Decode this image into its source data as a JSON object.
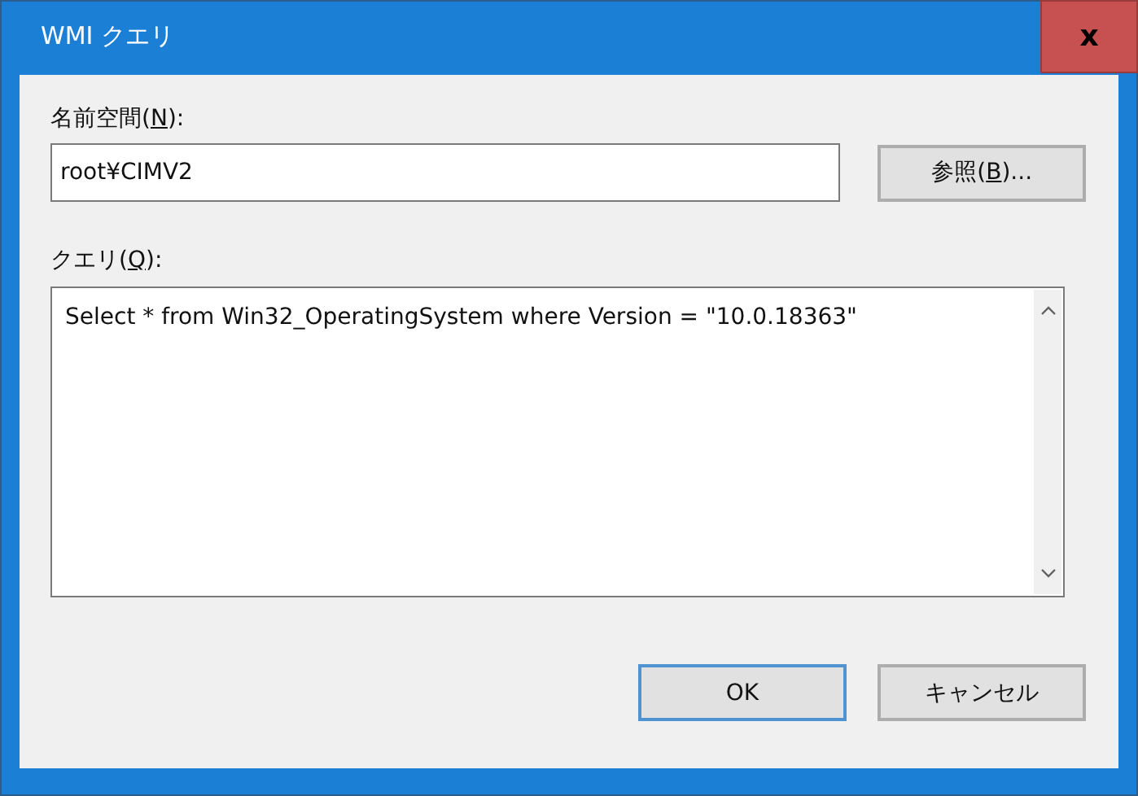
{
  "window": {
    "title": "WMI クエリ",
    "close": "x"
  },
  "namespace": {
    "label": {
      "text": "名前空間(",
      "key": "N",
      "after": "):"
    },
    "value": "root¥CIMV2",
    "browse": {
      "text": "参照(",
      "key": "B",
      "after": ")..."
    }
  },
  "query": {
    "label": {
      "text": "クエリ(",
      "key": "Q",
      "after": "):"
    },
    "value": "Select * from Win32_OperatingSystem where Version = \"10.0.18363\""
  },
  "buttons": [
    {
      "label": "OK",
      "default": true
    },
    {
      "label": "キャンセル",
      "default": false
    }
  ]
}
